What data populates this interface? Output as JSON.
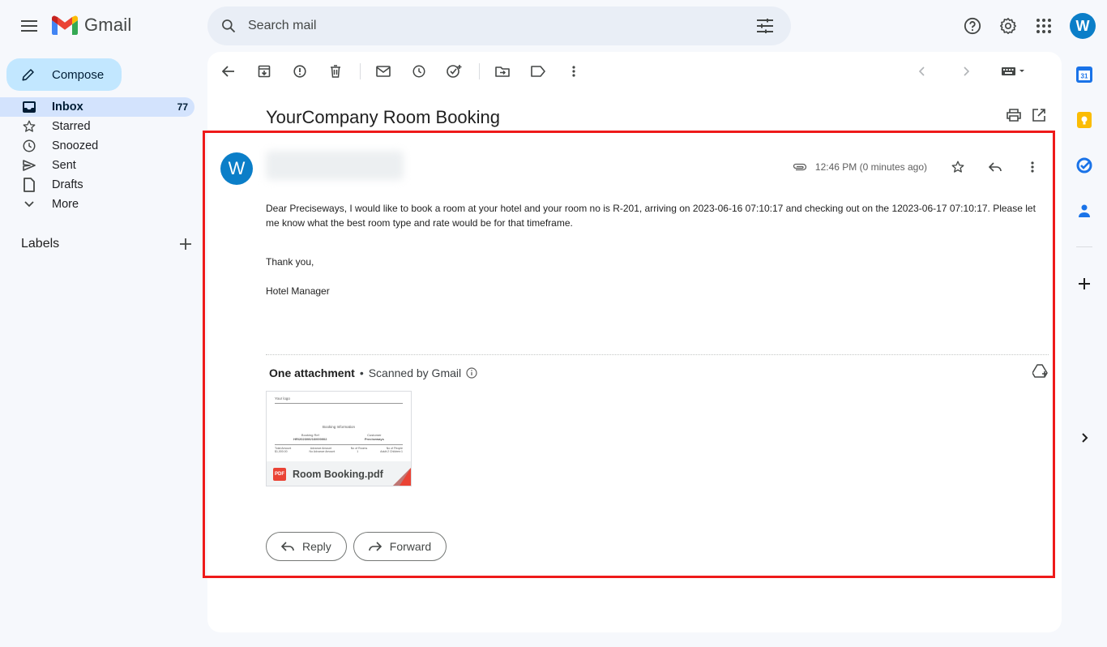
{
  "app": {
    "name": "Gmail"
  },
  "search": {
    "placeholder": "Search mail"
  },
  "user": {
    "initial": "W"
  },
  "sidebar": {
    "compose_label": "Compose",
    "items": [
      {
        "label": "Inbox",
        "count": "77",
        "icon": "inbox-icon",
        "active": true
      },
      {
        "label": "Starred",
        "icon": "star-icon"
      },
      {
        "label": "Snoozed",
        "icon": "clock-icon"
      },
      {
        "label": "Sent",
        "icon": "send-icon"
      },
      {
        "label": "Drafts",
        "icon": "draft-icon"
      },
      {
        "label": "More",
        "icon": "chevron-down-icon"
      }
    ],
    "labels_heading": "Labels"
  },
  "email": {
    "subject": "YourCompany Room Booking",
    "sender_initial": "W",
    "time": "12:46 PM (0 minutes ago)",
    "body": [
      "Dear Preciseways, I would like to book a room at your hotel and your room no is R-201, arriving on 2023-06-16 07:10:17 and checking out on the 12023-06-17 07:10:17. Please let me know what the best room type and rate would be for that timeframe.",
      "Thank you,",
      "Hotel Manager"
    ],
    "attachments_heading": "One attachment",
    "scanned_text": "Scanned by Gmail",
    "attachment": {
      "filename": "Room Booking.pdf",
      "badge": "PDF",
      "preview": {
        "logo": "Your logo",
        "title": "Booking Information",
        "booking_ref_label": "Booking Ref",
        "booking_ref": "HR/2023/06/16/000002",
        "customer_label": "Customer",
        "customer": "Preciseways",
        "cols": [
          "Total Amount",
          "Advance Amount",
          "No of Rooms",
          "No of People"
        ],
        "vals": [
          "$1,000.00",
          "No Advance Amount",
          "1",
          "Adult:2 Children:1"
        ]
      }
    },
    "reply_label": "Reply",
    "forward_label": "Forward"
  },
  "colors": {
    "accent": "#0b7ec8",
    "highlight": "#ee1a1a",
    "compose_bg": "#c2e7ff",
    "active_bg": "#d3e3fd"
  }
}
